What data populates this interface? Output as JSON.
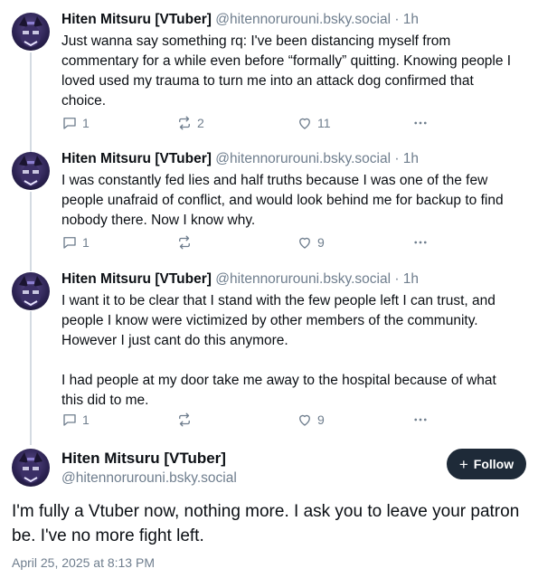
{
  "thread": [
    {
      "author": "Hiten Mitsuru [VTuber]",
      "handle_time": "@hitennorurouni.bsky.social · 1h",
      "text": "Just wanna say something rq: I've been distancing myself from commentary for a while even before “formally” quitting. Knowing people I loved used my trauma to turn me into an attack dog confirmed that choice.",
      "replies": "1",
      "reposts": "2",
      "likes": "11"
    },
    {
      "author": "Hiten Mitsuru [VTuber]",
      "handle_time": "@hitennorurouni.bsky.social · 1h",
      "text": "I was constantly fed lies and half truths because I was one of the few people unafraid of conflict, and would look behind me for backup to find nobody there. Now I know why.",
      "replies": "1",
      "reposts": "",
      "likes": "9"
    },
    {
      "author": "Hiten Mitsuru [VTuber]",
      "handle_time": "@hitennorurouni.bsky.social · 1h",
      "text": "I want it to be clear that I stand with the few people left I can trust, and people I know were victimized by other members of the community. However I just cant do this anymore.\n\nI had people at my door take me away to the hospital because of what this did to me.",
      "replies": "1",
      "reposts": "",
      "likes": "9"
    }
  ],
  "main_post": {
    "author": "Hiten Mitsuru [VTuber]",
    "handle": "@hitennorurouni.bsky.social",
    "follow_label": "Follow",
    "text": "I'm fully a Vtuber now, nothing more. I ask you to leave your patron be. I've no more fight left.",
    "timestamp": "April 25, 2025 at 8:13 PM"
  },
  "icons": {
    "reply": "speech-bubble-icon",
    "repost": "repost-arrows-icon",
    "like": "heart-icon",
    "more": "ellipsis-icon",
    "follow": "plus-icon"
  },
  "colors": {
    "text": "#0b0f14",
    "muted": "#6f7e8e",
    "thread_line": "#d4dbe2",
    "follow_bg": "#1e2a38"
  }
}
